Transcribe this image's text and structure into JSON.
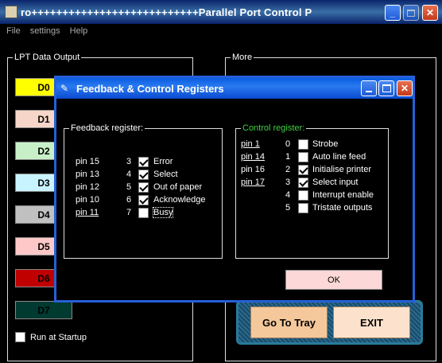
{
  "main_window": {
    "title": "ro+++++++++++++++++++++++++++Parallel Port   Control   P",
    "minimize_label": "_",
    "close_label": "✕"
  },
  "menu": {
    "items": [
      "File",
      "settings",
      "Help"
    ]
  },
  "lpt_output": {
    "label": "LPT Data Output",
    "buttons": [
      {
        "label": "D0",
        "color": "#ffff00"
      },
      {
        "label": "D1",
        "color": "#f6d6c8"
      },
      {
        "label": "D2",
        "color": "#c8f0c8"
      },
      {
        "label": "D3",
        "color": "#c8f4ff"
      },
      {
        "label": "D4",
        "color": "#c0c0c0"
      },
      {
        "label": "D5",
        "color": "#ffc8c8"
      },
      {
        "label": "D6",
        "color": "#c00000"
      },
      {
        "label": "D7",
        "color": "#003a30"
      }
    ],
    "run_at_startup_label": "Run at Startup"
  },
  "more": {
    "label": "More",
    "go_to_tray_label": "Go To Tray",
    "exit_label": "EXIT"
  },
  "dialog": {
    "title": "Feedback & Control Registers",
    "feedback_label": "Feedback register:",
    "feedback_rows": [
      {
        "pin": "pin 15",
        "bit": "3",
        "checked": true,
        "name": "Error"
      },
      {
        "pin": "pin 13",
        "bit": "4",
        "checked": true,
        "name": "Select"
      },
      {
        "pin": "pin 12",
        "bit": "5",
        "checked": true,
        "name": "Out of paper"
      },
      {
        "pin": "pin 10",
        "bit": "6",
        "checked": true,
        "name": "Acknowledge"
      },
      {
        "pin": "pin 11",
        "bit": "7",
        "checked": false,
        "name": "Busy"
      }
    ],
    "control_label": "Control register:",
    "control_rows": [
      {
        "pin": "pin 1",
        "bit": "0",
        "checked": false,
        "name": "Strobe"
      },
      {
        "pin": "pin 14",
        "bit": "1",
        "checked": false,
        "name": "Auto line feed"
      },
      {
        "pin": "pin 16",
        "bit": "2",
        "checked": true,
        "name": "Initialise printer"
      },
      {
        "pin": "pin 17",
        "bit": "3",
        "checked": true,
        "name": "Select input"
      },
      {
        "pin": "",
        "bit": "4",
        "checked": false,
        "name": "Interrupt enable"
      },
      {
        "pin": "",
        "bit": "5",
        "checked": false,
        "name": "Tristate outputs"
      }
    ],
    "ok_label": "OK"
  }
}
